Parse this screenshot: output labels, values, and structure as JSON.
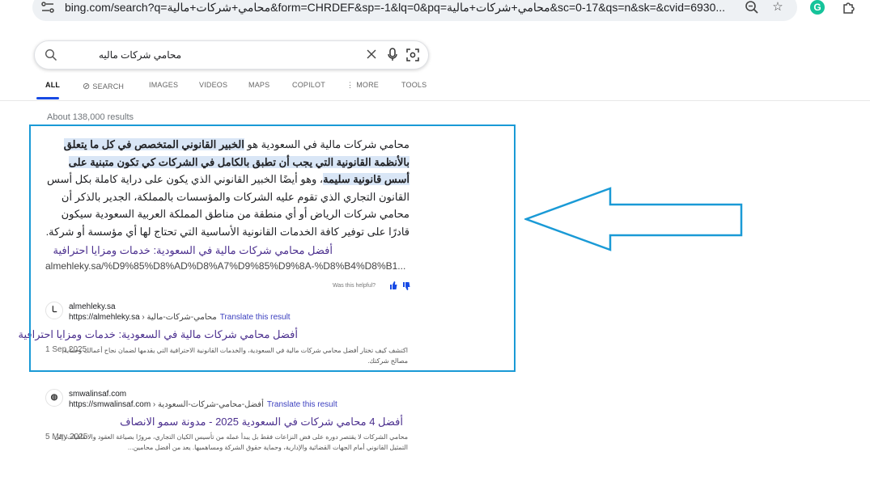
{
  "browser": {
    "url_host": "bing.com",
    "url_rest": "/search?q=محامي+شركات+مالية&form=CHRDEF&sp=-1&lq=0&pq=محامي+شركات+مالية&sc=0-17&qs=n&sk=&cvid=6930..."
  },
  "search": {
    "query": "محامي شركات ماليه"
  },
  "tabs": [
    "ALL",
    "SEARCH",
    "IMAGES",
    "VIDEOS",
    "MAPS",
    "COPILOT",
    "MORE",
    "TOOLS"
  ],
  "results_count": "About 138,000 results",
  "snippet": {
    "intro": "محامي شركات مالية في السعودية هو ",
    "bold": "الخبير القانوني المتخصص في كل ما يتعلق بالأنظمة القانونية التي يجب أن تطبق بالكامل في الشركات كي تكون متبنية على أسس قانونية سليمة",
    "rest": "، وهو أيضًا الخبير القانوني الذي يكون على دراية كاملة بكل أسس القانون التجاري الذي تقوم عليه الشركات والمؤسسات بالمملكة، الجدير بالذكر أن محامي شركات الرياض أو أي منطقة من مناطق المملكة العربية السعودية سيكون قادرًا على توفير كافة الخدمات القانونية الأساسية التي تحتاج لها أي مؤسسة أو شركة.",
    "link_title": "أفضل محامي شركات مالية في السعودية: خدمات ومزايا احترافية",
    "link_url": "almehleky.sa/%D9%85%D8%AD%D8%A7%D9%85%D9%8A-%D8%B4%D8%B1...",
    "helpful": "Was this helpful?"
  },
  "results": [
    {
      "favicon": "ـا",
      "site_name": "almehleky.sa",
      "url": "https://almehleky.sa",
      "path": " › محامي-شركات-مالية",
      "translate": "Translate this result",
      "title": "أفضل محامي شركات مالية في السعودية: خدمات ومزايا احترافية",
      "date": "1 Sep 2025",
      "snippet": "اكتشف كيف تختار أفضل محامي شركات مالية في السعودية، والخدمات القانونية الاحترافية التي يقدمها لضمان نجاح أعمالك وحماية مصالح شركتك."
    },
    {
      "favicon": "◍",
      "site_name": "smwalinsaf.com",
      "url": "https://smwalinsaf.com",
      "path": " › أفضل-محامي-شركات-السعودية",
      "translate": "Translate this result",
      "title": "أفضل 4 محامي شركات في السعودية 2025 - مدونة سمو الانصاف",
      "date": "5 May 2025",
      "snippet": "محامي الشركات لا يقتصر دوره على فض النزاعات فقط بل يبدأ عمله من تأسيس الكيان التجاري، مرورًا بصياغة العقود والاتفاقيات، إلى التمثيل القانوني أمام الجهات القضائية والإدارية، وحماية حقوق الشركة ومساهميها. يعد من أفضل محامين..."
    }
  ],
  "colors": {
    "accent": "#174ae4",
    "highlight_box": "#1a9ad6",
    "link": "#4b2f8e"
  }
}
